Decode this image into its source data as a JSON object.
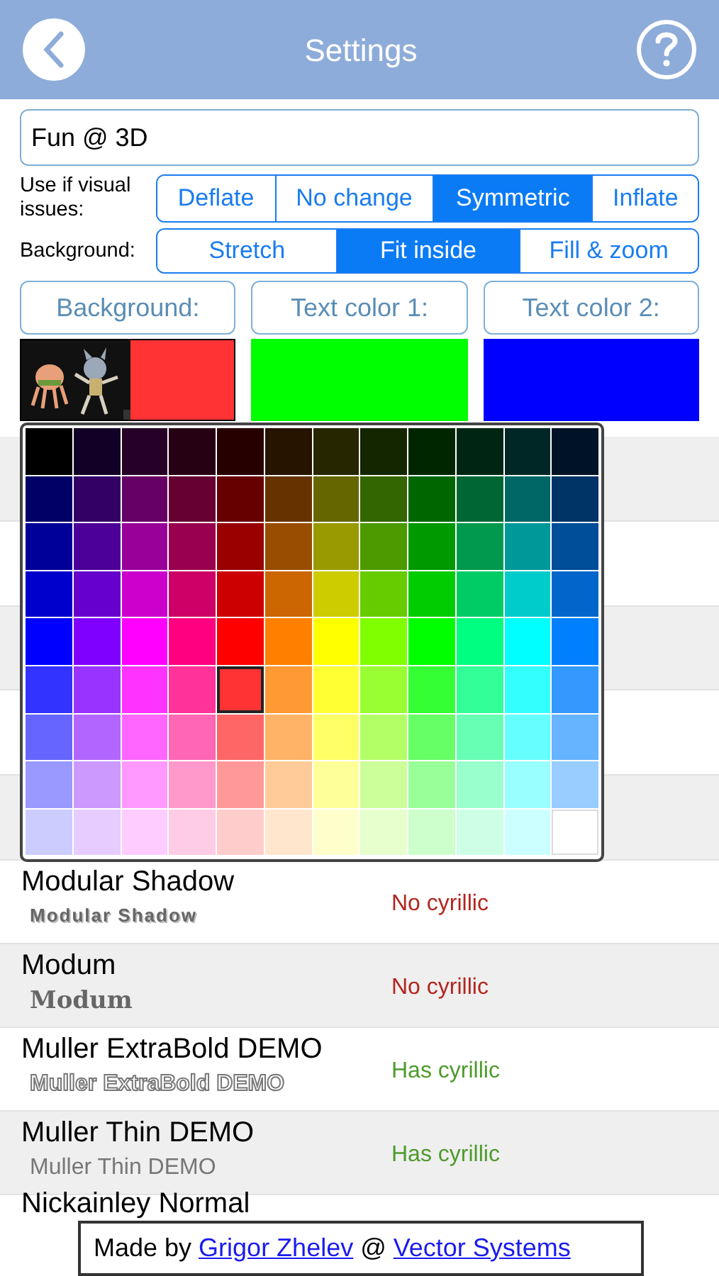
{
  "header": {
    "title": "Settings"
  },
  "name_field": {
    "value": "Fun @ 3D"
  },
  "visual_issues": {
    "label": "Use if visual issues:",
    "options": [
      {
        "label": "Deflate",
        "selected": false
      },
      {
        "label": "No change",
        "selected": false
      },
      {
        "label": "Symmetric",
        "selected": true
      },
      {
        "label": "Inflate",
        "selected": false
      }
    ]
  },
  "background_mode": {
    "label": "Background:",
    "options": [
      {
        "label": "Stretch",
        "selected": false
      },
      {
        "label": "Fit inside",
        "selected": true
      },
      {
        "label": "Fill & zoom",
        "selected": false
      }
    ]
  },
  "color_buttons": [
    {
      "label": "Background:"
    },
    {
      "label": "Text color 1:",
      "swatch": {
        "kind": "solid",
        "color": "#00ff00"
      }
    },
    {
      "label": "Text color 2:",
      "swatch": {
        "kind": "solid",
        "color": "#0000ff"
      }
    }
  ],
  "palette": {
    "rows": [
      {
        "swatches": [
          {
            "color": "#000000",
            "selected": false
          },
          {
            "color": "#130026",
            "selected": false
          },
          {
            "color": "#260026",
            "selected": false
          },
          {
            "color": "#260013",
            "selected": false
          },
          {
            "color": "#260000",
            "selected": false
          },
          {
            "color": "#261300",
            "selected": false
          },
          {
            "color": "#262600",
            "selected": false
          },
          {
            "color": "#132600",
            "selected": false
          },
          {
            "color": "#002600",
            "selected": false
          },
          {
            "color": "#002613",
            "selected": false
          },
          {
            "color": "#002626",
            "selected": false
          },
          {
            "color": "#001326",
            "selected": false
          }
        ]
      },
      {
        "swatches": [
          {
            "color": "#000066",
            "selected": false
          },
          {
            "color": "#330066",
            "selected": false
          },
          {
            "color": "#660066",
            "selected": false
          },
          {
            "color": "#660033",
            "selected": false
          },
          {
            "color": "#660000",
            "selected": false
          },
          {
            "color": "#663300",
            "selected": false
          },
          {
            "color": "#666600",
            "selected": false
          },
          {
            "color": "#336600",
            "selected": false
          },
          {
            "color": "#006600",
            "selected": false
          },
          {
            "color": "#006633",
            "selected": false
          },
          {
            "color": "#006666",
            "selected": false
          },
          {
            "color": "#003366",
            "selected": false
          }
        ]
      },
      {
        "swatches": [
          {
            "color": "#000099",
            "selected": false
          },
          {
            "color": "#4d0099",
            "selected": false
          },
          {
            "color": "#990099",
            "selected": false
          },
          {
            "color": "#99004d",
            "selected": false
          },
          {
            "color": "#990000",
            "selected": false
          },
          {
            "color": "#994d00",
            "selected": false
          },
          {
            "color": "#999900",
            "selected": false
          },
          {
            "color": "#4d9900",
            "selected": false
          },
          {
            "color": "#009900",
            "selected": false
          },
          {
            "color": "#00994d",
            "selected": false
          },
          {
            "color": "#009999",
            "selected": false
          },
          {
            "color": "#004d99",
            "selected": false
          }
        ]
      },
      {
        "swatches": [
          {
            "color": "#0000cc",
            "selected": false
          },
          {
            "color": "#6600cc",
            "selected": false
          },
          {
            "color": "#cc00cc",
            "selected": false
          },
          {
            "color": "#cc0066",
            "selected": false
          },
          {
            "color": "#cc0000",
            "selected": false
          },
          {
            "color": "#cc6600",
            "selected": false
          },
          {
            "color": "#cccc00",
            "selected": false
          },
          {
            "color": "#66cc00",
            "selected": false
          },
          {
            "color": "#00cc00",
            "selected": false
          },
          {
            "color": "#00cc66",
            "selected": false
          },
          {
            "color": "#00cccc",
            "selected": false
          },
          {
            "color": "#0066cc",
            "selected": false
          }
        ]
      },
      {
        "swatches": [
          {
            "color": "#0000ff",
            "selected": false
          },
          {
            "color": "#8000ff",
            "selected": false
          },
          {
            "color": "#ff00ff",
            "selected": false
          },
          {
            "color": "#ff0080",
            "selected": false
          },
          {
            "color": "#ff0000",
            "selected": false
          },
          {
            "color": "#ff8000",
            "selected": false
          },
          {
            "color": "#ffff00",
            "selected": false
          },
          {
            "color": "#80ff00",
            "selected": false
          },
          {
            "color": "#00ff00",
            "selected": false
          },
          {
            "color": "#00ff80",
            "selected": false
          },
          {
            "color": "#00ffff",
            "selected": false
          },
          {
            "color": "#0080ff",
            "selected": false
          }
        ]
      },
      {
        "swatches": [
          {
            "color": "#3333ff",
            "selected": false
          },
          {
            "color": "#9933ff",
            "selected": false
          },
          {
            "color": "#ff33ff",
            "selected": false
          },
          {
            "color": "#ff3399",
            "selected": false
          },
          {
            "color": "#ff3333",
            "selected": true
          },
          {
            "color": "#ff9933",
            "selected": false
          },
          {
            "color": "#ffff33",
            "selected": false
          },
          {
            "color": "#99ff33",
            "selected": false
          },
          {
            "color": "#33ff33",
            "selected": false
          },
          {
            "color": "#33ff99",
            "selected": false
          },
          {
            "color": "#33ffff",
            "selected": false
          },
          {
            "color": "#3399ff",
            "selected": false
          }
        ]
      },
      {
        "swatches": [
          {
            "color": "#6666ff",
            "selected": false
          },
          {
            "color": "#b366ff",
            "selected": false
          },
          {
            "color": "#ff66ff",
            "selected": false
          },
          {
            "color": "#ff66b3",
            "selected": false
          },
          {
            "color": "#ff6666",
            "selected": false
          },
          {
            "color": "#ffb366",
            "selected": false
          },
          {
            "color": "#ffff66",
            "selected": false
          },
          {
            "color": "#b3ff66",
            "selected": false
          },
          {
            "color": "#66ff66",
            "selected": false
          },
          {
            "color": "#66ffb3",
            "selected": false
          },
          {
            "color": "#66ffff",
            "selected": false
          },
          {
            "color": "#66b3ff",
            "selected": false
          }
        ]
      },
      {
        "swatches": [
          {
            "color": "#9999ff",
            "selected": false
          },
          {
            "color": "#cc99ff",
            "selected": false
          },
          {
            "color": "#ff99ff",
            "selected": false
          },
          {
            "color": "#ff99cc",
            "selected": false
          },
          {
            "color": "#ff9999",
            "selected": false
          },
          {
            "color": "#ffcc99",
            "selected": false
          },
          {
            "color": "#ffff99",
            "selected": false
          },
          {
            "color": "#ccff99",
            "selected": false
          },
          {
            "color": "#99ff99",
            "selected": false
          },
          {
            "color": "#99ffcc",
            "selected": false
          },
          {
            "color": "#99ffff",
            "selected": false
          },
          {
            "color": "#99ccff",
            "selected": false
          }
        ]
      },
      {
        "swatches": [
          {
            "color": "#ccccff",
            "selected": false
          },
          {
            "color": "#e6ccff",
            "selected": false
          },
          {
            "color": "#ffccff",
            "selected": false
          },
          {
            "color": "#ffcce6",
            "selected": false
          },
          {
            "color": "#ffcccc",
            "selected": false
          },
          {
            "color": "#ffe6cc",
            "selected": false
          },
          {
            "color": "#ffffcc",
            "selected": false
          },
          {
            "color": "#e6ffcc",
            "selected": false
          },
          {
            "color": "#ccffcc",
            "selected": false
          },
          {
            "color": "#ccffe6",
            "selected": false
          },
          {
            "color": "#ccffff",
            "selected": false
          },
          {
            "color": "#ffffff",
            "selected": false
          }
        ]
      }
    ]
  },
  "fonts": [
    {
      "name": "Modular Shadow",
      "sample": "Modular Shadow",
      "kind": "shadow",
      "status": "No cyrillic",
      "cyrillic": false
    },
    {
      "name": "Modum",
      "sample": "Modum",
      "kind": "serif",
      "status": "No cyrillic",
      "cyrillic": false
    },
    {
      "name": "Muller ExtraBold DEMO",
      "sample": "Muller ExtraBold DEMO",
      "kind": "outline",
      "status": "Has cyrillic",
      "cyrillic": true
    },
    {
      "name": "Muller Thin DEMO",
      "sample": "Muller Thin DEMO",
      "kind": "thin",
      "status": "Has cyrillic",
      "cyrillic": true
    },
    {
      "name": "Nickainley Normal",
      "kind": "cut"
    }
  ],
  "footer": {
    "prefix": "Made by",
    "author": "Grigor Zhelev",
    "separator": "@",
    "company": "Vector Systems"
  }
}
